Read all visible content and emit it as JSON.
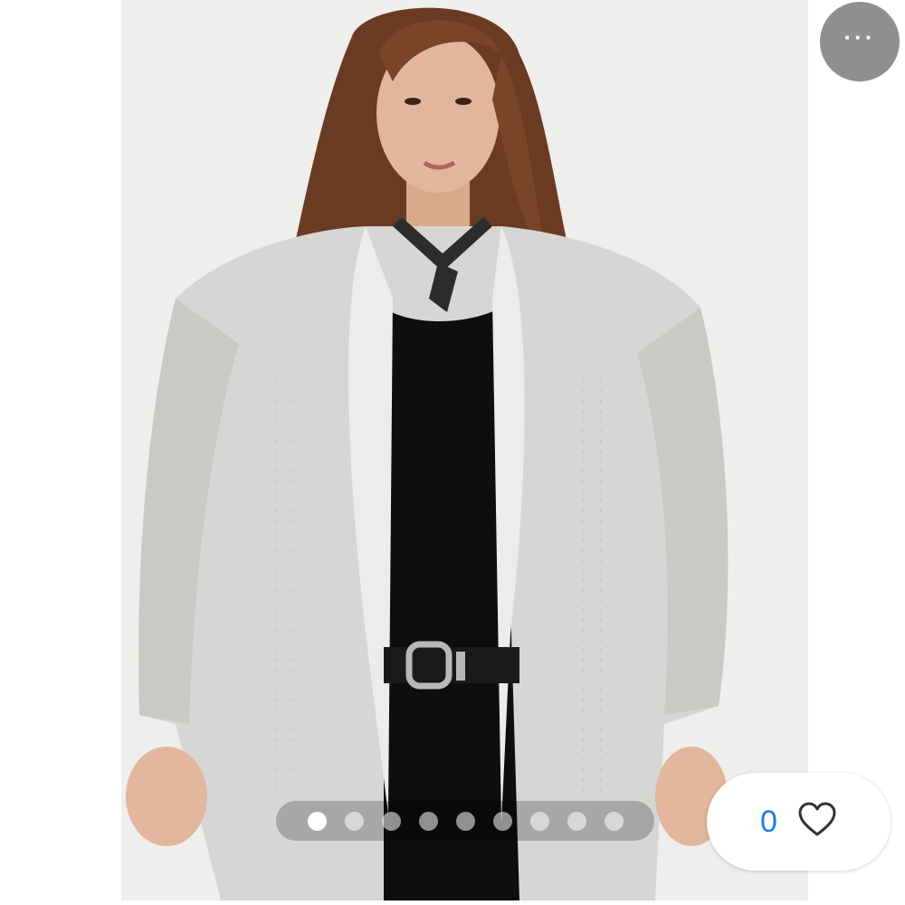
{
  "product_image": {
    "subject": "model-wearing-gray-cardigan"
  },
  "more_button": {
    "icon": "ellipsis-icon",
    "glyph": "···"
  },
  "carousel": {
    "total": 9,
    "active_index": 0
  },
  "likes": {
    "count": "0",
    "icon": "heart-outline-icon",
    "count_color": "#1b7fe0"
  },
  "colors": {
    "background": "#ffffff",
    "photo_bg": "#eeeeec",
    "cardigan": "#d6d6d4",
    "top": "#0e0e0e",
    "hair": "#6b3a22",
    "skin": "#e2b69d"
  }
}
